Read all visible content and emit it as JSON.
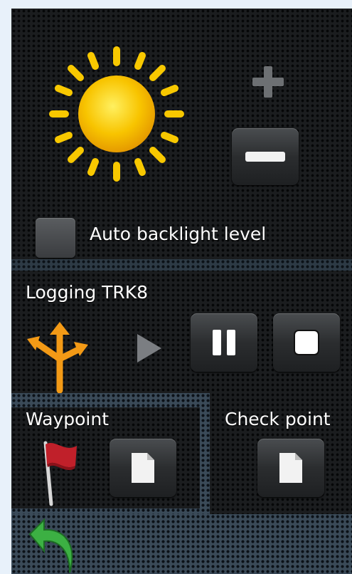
{
  "brightness": {
    "sun_icon": "sun-icon",
    "increase_icon": "plus-icon",
    "decrease_icon": "minus-icon",
    "auto_backlight_label": "Auto backlight level",
    "auto_backlight_checked": false
  },
  "logging": {
    "title": "Logging TRK8",
    "route_icon": "route-arrows-icon",
    "play_icon": "play-icon",
    "pause_icon": "pause-icon",
    "stop_icon": "stop-icon"
  },
  "waypoint": {
    "label": "Waypoint",
    "flag_icon": "flag-icon",
    "add_icon": "document-icon"
  },
  "checkpoint": {
    "label": "Check point",
    "add_icon": "document-icon"
  },
  "nav": {
    "back_icon": "back-arrow-icon"
  },
  "colors": {
    "sun": "#f5b800",
    "route_arrows": "#f39a16",
    "back_arrow": "#3cb043",
    "flag": "#c0202a"
  }
}
